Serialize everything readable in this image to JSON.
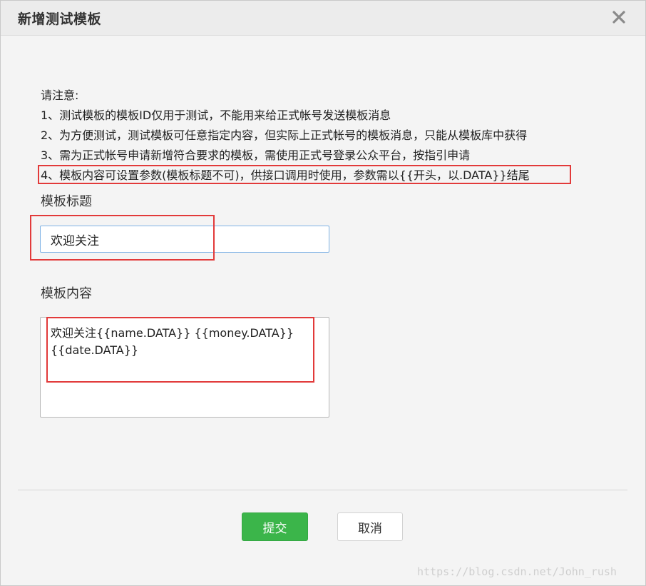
{
  "dialog": {
    "title": "新增测试模板",
    "close_icon": "close-icon"
  },
  "notice": {
    "heading": "请注意:",
    "items": [
      "1、测试模板的模板ID仅用于测试，不能用来给正式帐号发送模板消息",
      "2、为方便测试，测试模板可任意指定内容，但实际上正式帐号的模板消息，只能从模板库中获得",
      "3、需为正式帐号申请新增符合要求的模板，需使用正式号登录公众平台，按指引申请",
      "4、模板内容可设置参数(模板标题不可)，供接口调用时使用，参数需以{{开头，以.DATA}}结尾"
    ]
  },
  "form": {
    "title_label": "模板标题",
    "title_value": "欢迎关注",
    "content_label": "模板内容",
    "content_value": "欢迎关注{{name.DATA}} {{money.DATA}} {{date.DATA}}"
  },
  "buttons": {
    "submit": "提交",
    "cancel": "取消"
  },
  "watermark": "https://blog.csdn.net/John_rush",
  "colors": {
    "annotation": "#e23a3a",
    "primary": "#3bb54a",
    "input_focus": "#7fb2e5"
  }
}
